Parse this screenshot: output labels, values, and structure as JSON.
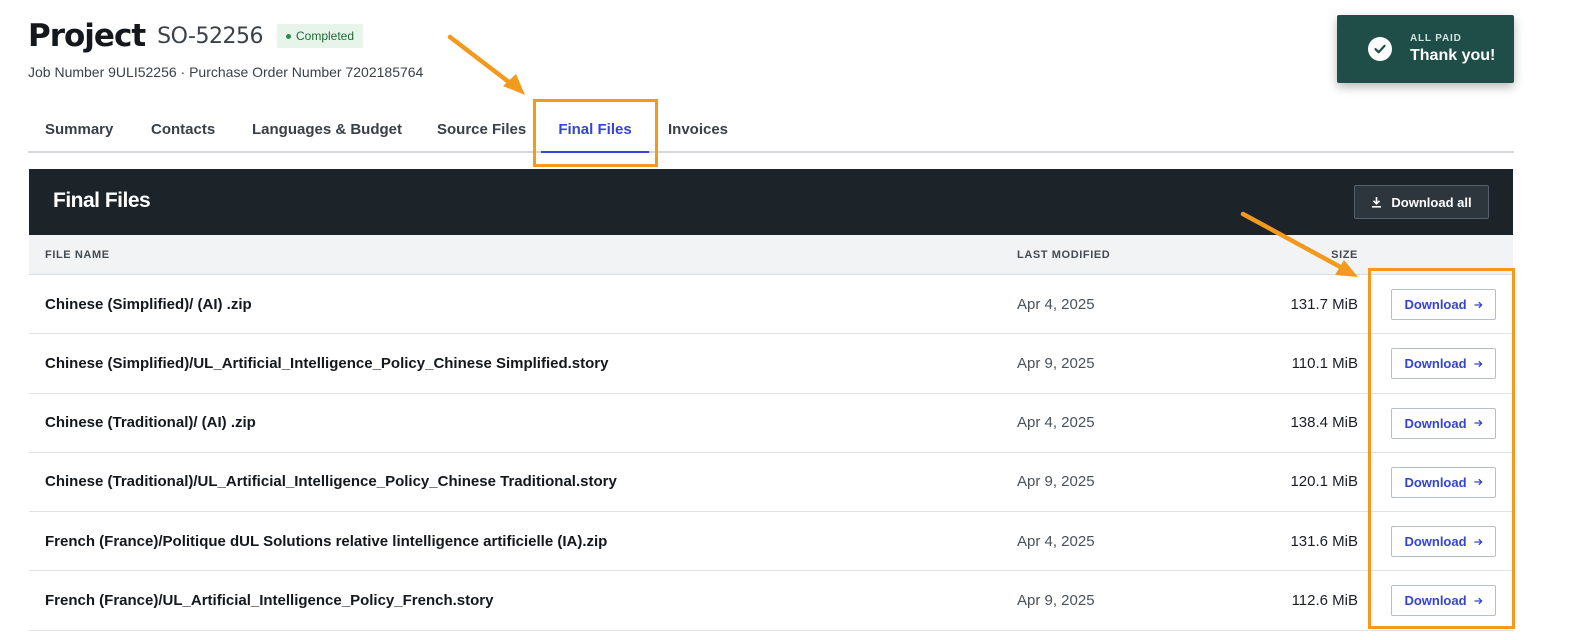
{
  "project": {
    "title": "Project",
    "id": "SO-52256",
    "status": "Completed",
    "subline": "Job Number 9ULI52256 · Purchase Order Number 7202185764"
  },
  "toast": {
    "label": "ALL PAID",
    "message": "Thank you!",
    "icon": "check-circle-icon"
  },
  "tabs": [
    {
      "label": "Summary"
    },
    {
      "label": "Contacts"
    },
    {
      "label": "Languages & Budget"
    },
    {
      "label": "Source Files"
    },
    {
      "label": "Final Files",
      "active": true
    },
    {
      "label": "Invoices"
    }
  ],
  "panel": {
    "title": "Final Files",
    "download_all_label": "Download all"
  },
  "table": {
    "columns": [
      "FILE NAME",
      "LAST MODIFIED",
      "SIZE"
    ],
    "rows": [
      {
        "name": "Chinese (Simplified)/ (AI) .zip",
        "modified": "Apr 4, 2025",
        "size": "131.7 MiB",
        "action": "Download"
      },
      {
        "name": "Chinese (Simplified)/UL_Artificial_Intelligence_Policy_Chinese Simplified.story",
        "modified": "Apr 9, 2025",
        "size": "110.1 MiB",
        "action": "Download"
      },
      {
        "name": "Chinese (Traditional)/ (AI) .zip",
        "modified": "Apr 4, 2025",
        "size": "138.4 MiB",
        "action": "Download"
      },
      {
        "name": "Chinese (Traditional)/UL_Artificial_Intelligence_Policy_Chinese Traditional.story",
        "modified": "Apr 9, 2025",
        "size": "120.1 MiB",
        "action": "Download"
      },
      {
        "name": "French (France)/Politique dUL Solutions relative lintelligence artificielle (IA).zip",
        "modified": "Apr 4, 2025",
        "size": "131.6 MiB",
        "action": "Download"
      },
      {
        "name": "French (France)/UL_Artificial_Intelligence_Policy_French.story",
        "modified": "Apr 9, 2025",
        "size": "112.6 MiB",
        "action": "Download"
      }
    ]
  },
  "colors": {
    "accent": "#3344d6",
    "highlight": "#f39a1e",
    "toast_bg": "#1f4d47",
    "panel_bg": "#1c2329",
    "status_green": "#1e6b38"
  }
}
